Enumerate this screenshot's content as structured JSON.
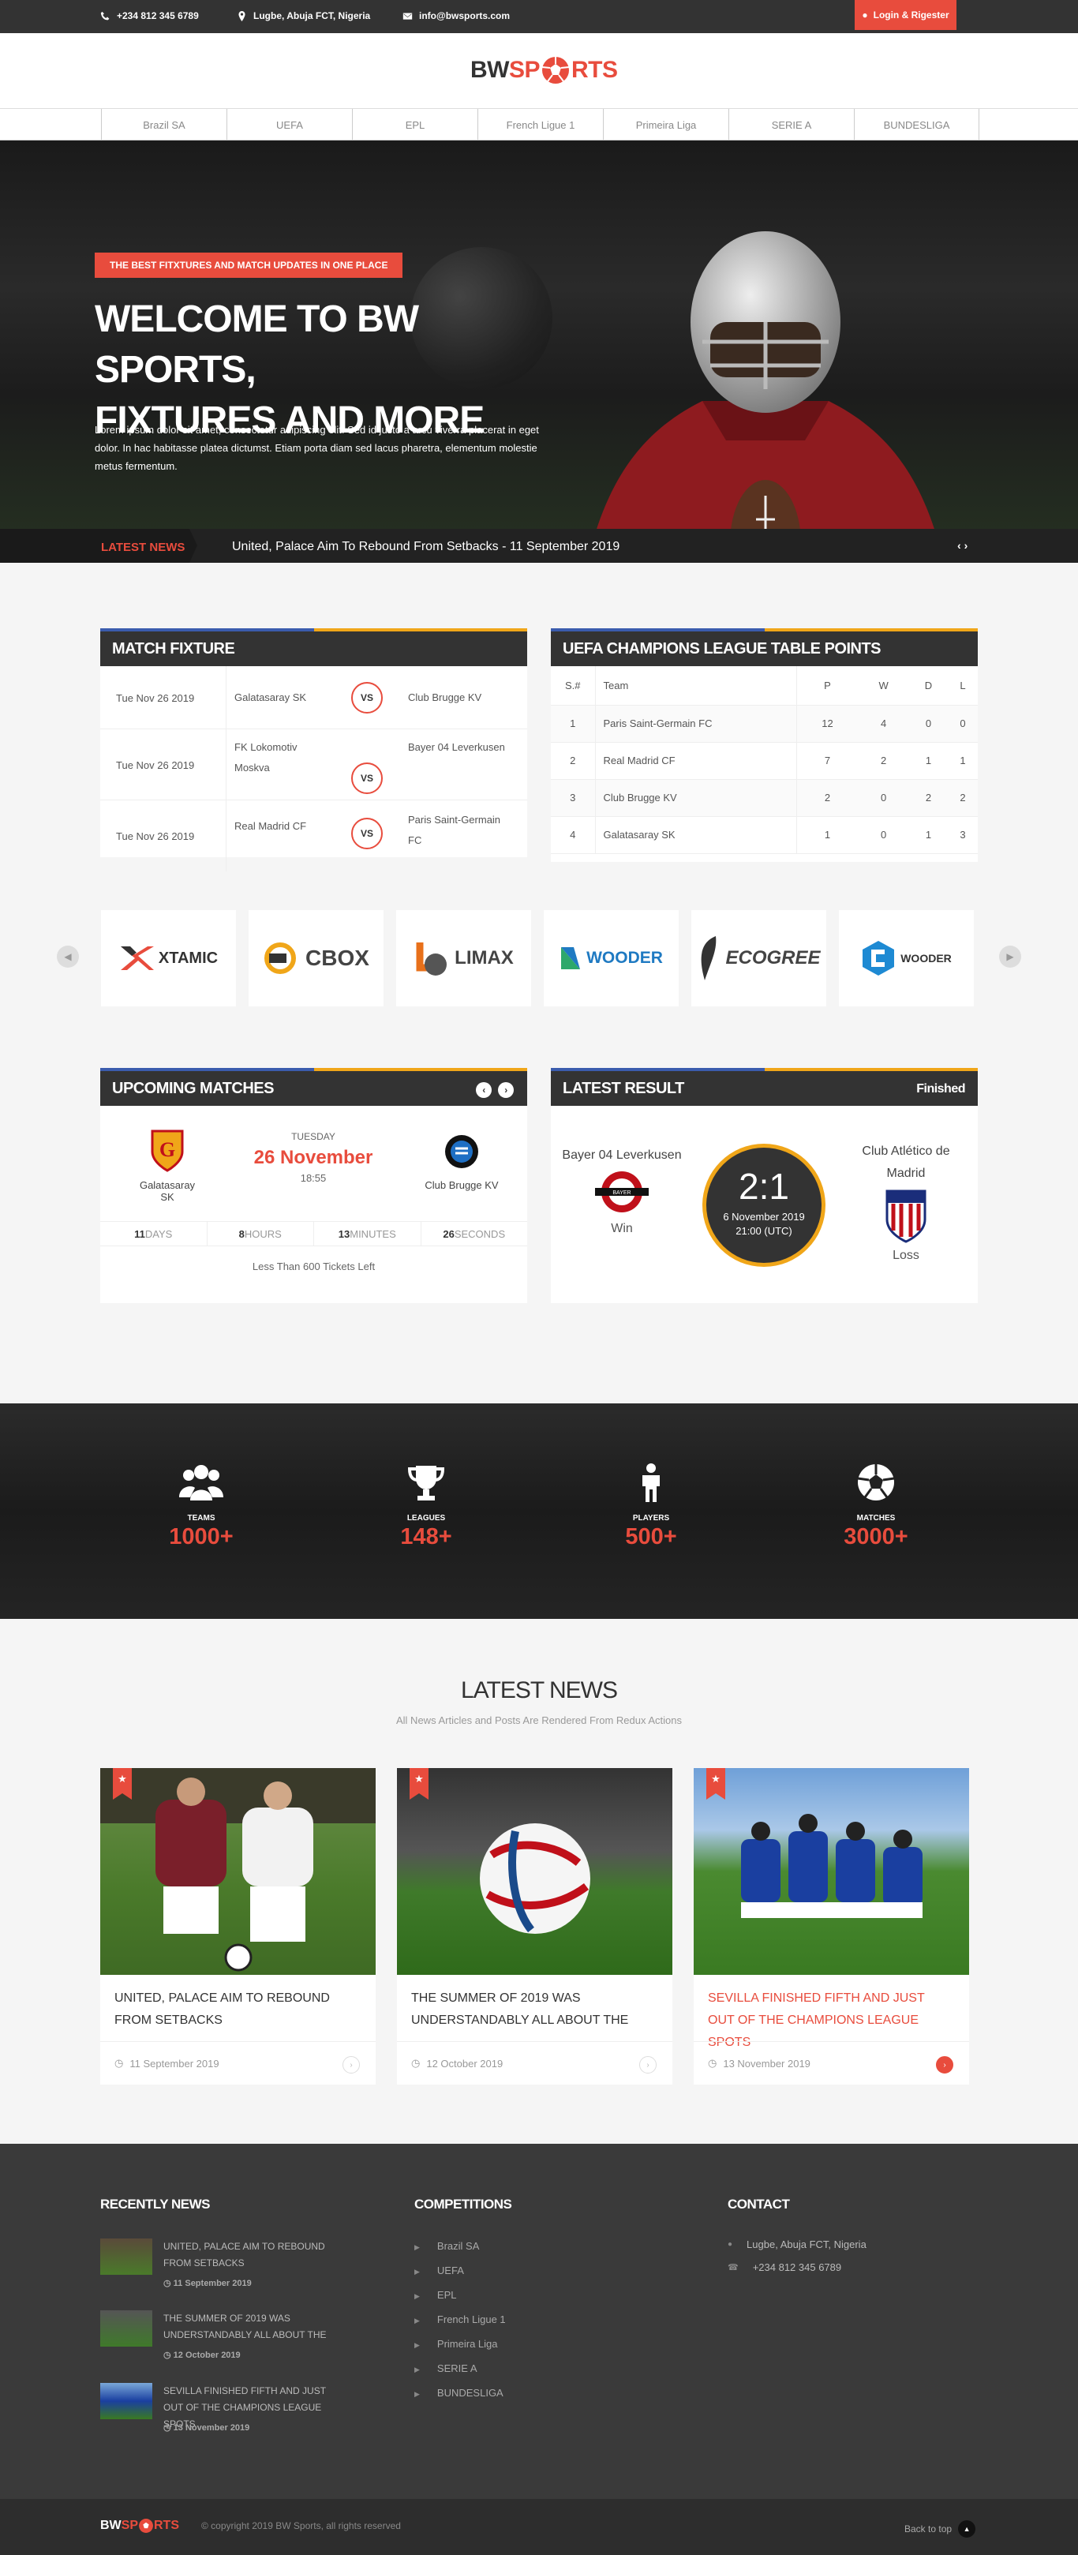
{
  "topbar": {
    "phone": "+234 812 345 6789",
    "location": "Lugbe, Abuja FCT, Nigeria",
    "email": "info@bwsports.com",
    "login_label": "Login & Rigester"
  },
  "logo": {
    "left": "BW",
    "mid": "SP",
    "right": "RTS"
  },
  "leagues": [
    "Brazil SA",
    "UEFA",
    "EPL",
    "French Ligue 1",
    "Primeira Liga",
    "SERIE A",
    "BUNDESLIGA"
  ],
  "hero": {
    "tag": "THE BEST FITXTURES AND MATCH UPDATES IN ONE PLACE",
    "title_line1": "WELCOME TO BW SPORTS,",
    "title_line2": "FIXTURES AND MORE",
    "text": "Lorem ipsum dolor sit amet, consectetur adipiscing elit. Sed id justo a arcu viverra placerat in eget dolor. In hac habitasse platea dictumst. Etiam porta diam sed lacus pharetra, elementum molestie metus fermentum.",
    "news_label": "LATEST NEWS",
    "news_text": "United, Palace Aim To Rebound From Setbacks - 11 September 2019"
  },
  "fixture": {
    "title": "MATCH FIXTURE",
    "vs": "VS",
    "rows": [
      {
        "date": "Tue Nov 26 2019",
        "home": "Galatasaray SK",
        "away": "Club Brugge KV"
      },
      {
        "date": "Tue Nov 26 2019",
        "home": "FK Lokomotiv Moskva",
        "away": "Bayer 04 Leverkusen"
      },
      {
        "date": "Tue Nov 26 2019",
        "home": "Real Madrid CF",
        "away": "Paris Saint-Germain FC"
      }
    ]
  },
  "table": {
    "title": "UEFA CHAMPIONS LEAGUE TABLE POINTS",
    "headers": [
      "S.#",
      "Team",
      "P",
      "W",
      "D",
      "L"
    ],
    "rows": [
      [
        "1",
        "Paris Saint-Germain FC",
        "12",
        "4",
        "0",
        "0"
      ],
      [
        "2",
        "Real Madrid CF",
        "7",
        "2",
        "1",
        "1"
      ],
      [
        "3",
        "Club Brugge KV",
        "2",
        "0",
        "2",
        "2"
      ],
      [
        "4",
        "Galatasaray SK",
        "1",
        "0",
        "1",
        "3"
      ]
    ]
  },
  "brands": [
    "XTAMIC",
    "CBOX",
    "LIMAX",
    "WOODER",
    "ECOGREE",
    "WOODER"
  ],
  "upcoming": {
    "title": "UPCOMING MATCHES",
    "home": "Galatasaray SK",
    "away": "Club Brugge KV",
    "day": "TUESDAY",
    "date": "26 November",
    "time": "18:55",
    "countdown": [
      {
        "num": "11",
        "unit": "DAYS"
      },
      {
        "num": "8",
        "unit": "HOURS"
      },
      {
        "num": "13",
        "unit": "MINUTES"
      },
      {
        "num": "26",
        "unit": "SECONDS"
      }
    ],
    "tickets": "Less Than 600 Tickets Left"
  },
  "result": {
    "title": "LATEST RESULT",
    "status": "Finished",
    "home": "Bayer 04 Leverkusen",
    "home_outcome": "Win",
    "away": "Club Atlético de Madrid",
    "away_outcome": "Loss",
    "score": "2:1",
    "date": "6 November 2019",
    "time": "21:00 (UTC)"
  },
  "stats": [
    {
      "label": "TEAMS",
      "value": "1000+",
      "icon": "users-icon"
    },
    {
      "label": "LEAGUES",
      "value": "148+",
      "icon": "trophy-icon"
    },
    {
      "label": "PLAYERS",
      "value": "500+",
      "icon": "player-icon"
    },
    {
      "label": "MATCHES",
      "value": "3000+",
      "icon": "ball-icon"
    }
  ],
  "latest_news": {
    "title": "LATEST NEWS",
    "subtitle": "All News Articles and Posts Are Rendered From Redux Actions",
    "items": [
      {
        "title": "UNITED, PALACE AIM TO REBOUND FROM SETBACKS",
        "date": "11 September 2019"
      },
      {
        "title": "THE SUMMER OF 2019 WAS UNDERSTANDABLY ALL ABOUT THE",
        "date": "12 October 2019"
      },
      {
        "title": "SEVILLA FINISHED FIFTH AND JUST OUT OF THE CHAMPIONS LEAGUE SPOTS",
        "date": "13 November 2019"
      }
    ]
  },
  "footer": {
    "recent_title": "RECENTLY NEWS",
    "recent": [
      {
        "title": "UNITED, PALACE AIM TO REBOUND FROM SETBACKS",
        "date": "11 September 2019"
      },
      {
        "title": "THE SUMMER OF 2019 WAS UNDERSTANDABLY ALL ABOUT THE",
        "date": "12 October 2019"
      },
      {
        "title": "SEVILLA FINISHED FIFTH AND JUST OUT OF THE CHAMPIONS LEAGUE SPOTS",
        "date": "13 November 2019"
      }
    ],
    "competitions_title": "COMPETITIONS",
    "competitions": [
      "Brazil SA",
      "UEFA",
      "EPL",
      "French Ligue 1",
      "Primeira Liga",
      "SERIE A",
      "BUNDESLIGA"
    ],
    "contact_title": "CONTACT",
    "address": "Lugbe, Abuja FCT, Nigeria",
    "phone": "+234 812 345 6789",
    "copyright": "© copyright 2019 BW Sports, all rights reserved",
    "back_to_top": "Back to top"
  },
  "colors": {
    "accent": "#e84c3d",
    "dark": "#333333",
    "blue": "#3b5cad",
    "gold": "#f0a619"
  }
}
